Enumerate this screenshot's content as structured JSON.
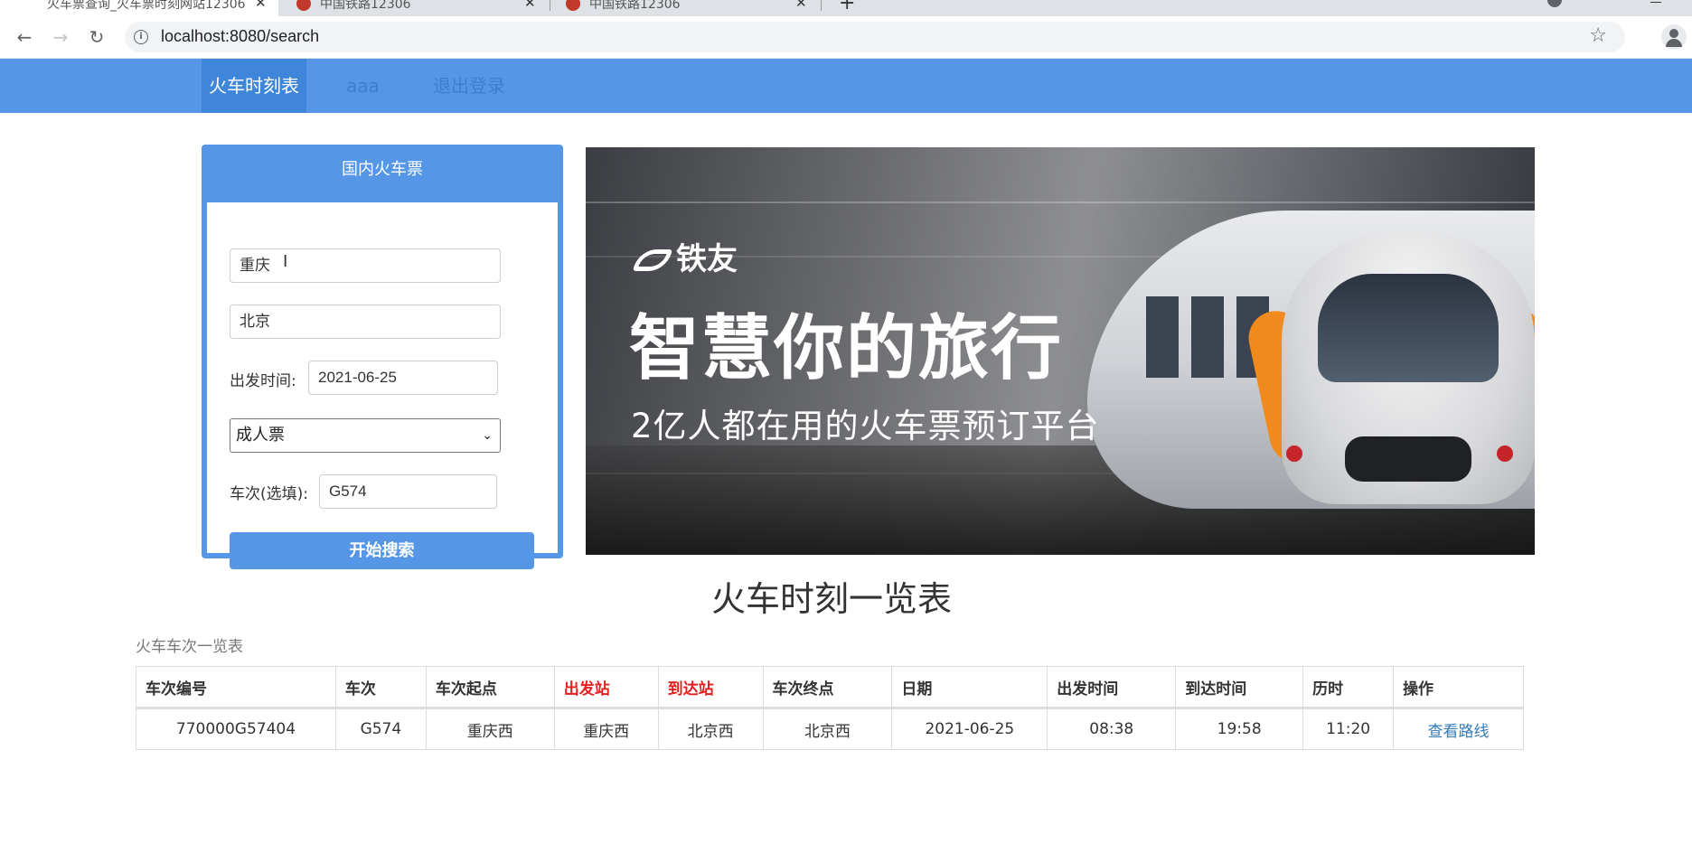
{
  "browser": {
    "tabs": [
      {
        "title": "火车票查询_火车票时刻网站12306",
        "active": true
      },
      {
        "title": "中国铁路12306",
        "active": false
      },
      {
        "title": "中国铁路12306",
        "active": false
      }
    ],
    "url": "localhost:8080/search"
  },
  "nav": {
    "items": [
      {
        "label": "火车时刻表",
        "active": true
      },
      {
        "label": "aaa",
        "active": false
      },
      {
        "label": "退出登录",
        "active": false
      }
    ]
  },
  "search_panel": {
    "title": "国内火车票",
    "from_value": "重庆",
    "to_value": "北京",
    "date_label": "出发时间:",
    "date_value": "2021-06-25",
    "ticket_type_selected": "成人票",
    "train_no_label": "车次(选填):",
    "train_no_value": "G574",
    "search_button": "开始搜索"
  },
  "banner": {
    "logo": "铁友",
    "headline": "智慧你的旅行",
    "subline": "2亿人都在用的火车票预订平台"
  },
  "schedule": {
    "title": "火车时刻一览表",
    "caption": "火车车次一览表",
    "headers": [
      "车次编号",
      "车次",
      "车次起点",
      "出发站",
      "到达站",
      "车次终点",
      "日期",
      "出发时间",
      "到达时间",
      "历时",
      "操作"
    ],
    "rows": [
      [
        "770000G57404",
        "G574",
        "重庆西",
        "重庆西",
        "北京西",
        "北京西",
        "2021-06-25",
        "08:38",
        "19:58",
        "11:20",
        "查看路线"
      ]
    ]
  },
  "colors": {
    "nav_bg": "#5597e6",
    "highlight_header": "#e51e1e",
    "link": "#337ab7"
  }
}
